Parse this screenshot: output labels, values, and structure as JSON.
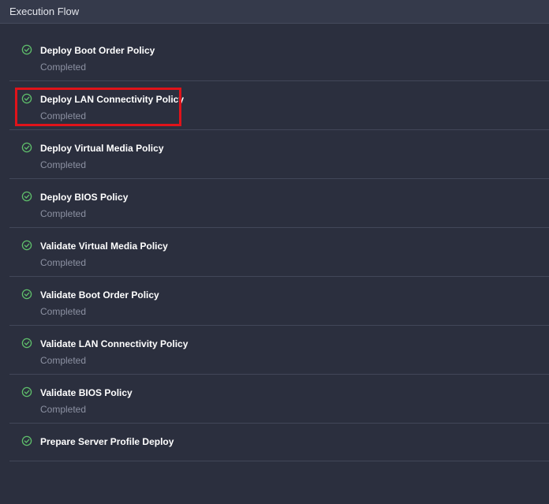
{
  "panel": {
    "title": "Execution Flow"
  },
  "steps": [
    {
      "title": "Deploy Boot Order Policy",
      "status": "Completed",
      "icon": "check-circle-icon"
    },
    {
      "title": "Deploy LAN Connectivity Policy",
      "status": "Completed",
      "icon": "check-circle-icon",
      "highlighted": true
    },
    {
      "title": "Deploy Virtual Media Policy",
      "status": "Completed",
      "icon": "check-circle-icon"
    },
    {
      "title": "Deploy BIOS Policy",
      "status": "Completed",
      "icon": "check-circle-icon"
    },
    {
      "title": "Validate Virtual Media Policy",
      "status": "Completed",
      "icon": "check-circle-icon"
    },
    {
      "title": "Validate Boot Order Policy",
      "status": "Completed",
      "icon": "check-circle-icon"
    },
    {
      "title": "Validate LAN Connectivity Policy",
      "status": "Completed",
      "icon": "check-circle-icon"
    },
    {
      "title": "Validate BIOS Policy",
      "status": "Completed",
      "icon": "check-circle-icon"
    },
    {
      "title": "Prepare Server Profile Deploy",
      "status": "",
      "icon": "check-circle-icon"
    }
  ],
  "colors": {
    "background": "#2b2f3e",
    "header": "#353a4b",
    "success": "#5fbf6b",
    "highlight": "#e0131a"
  }
}
